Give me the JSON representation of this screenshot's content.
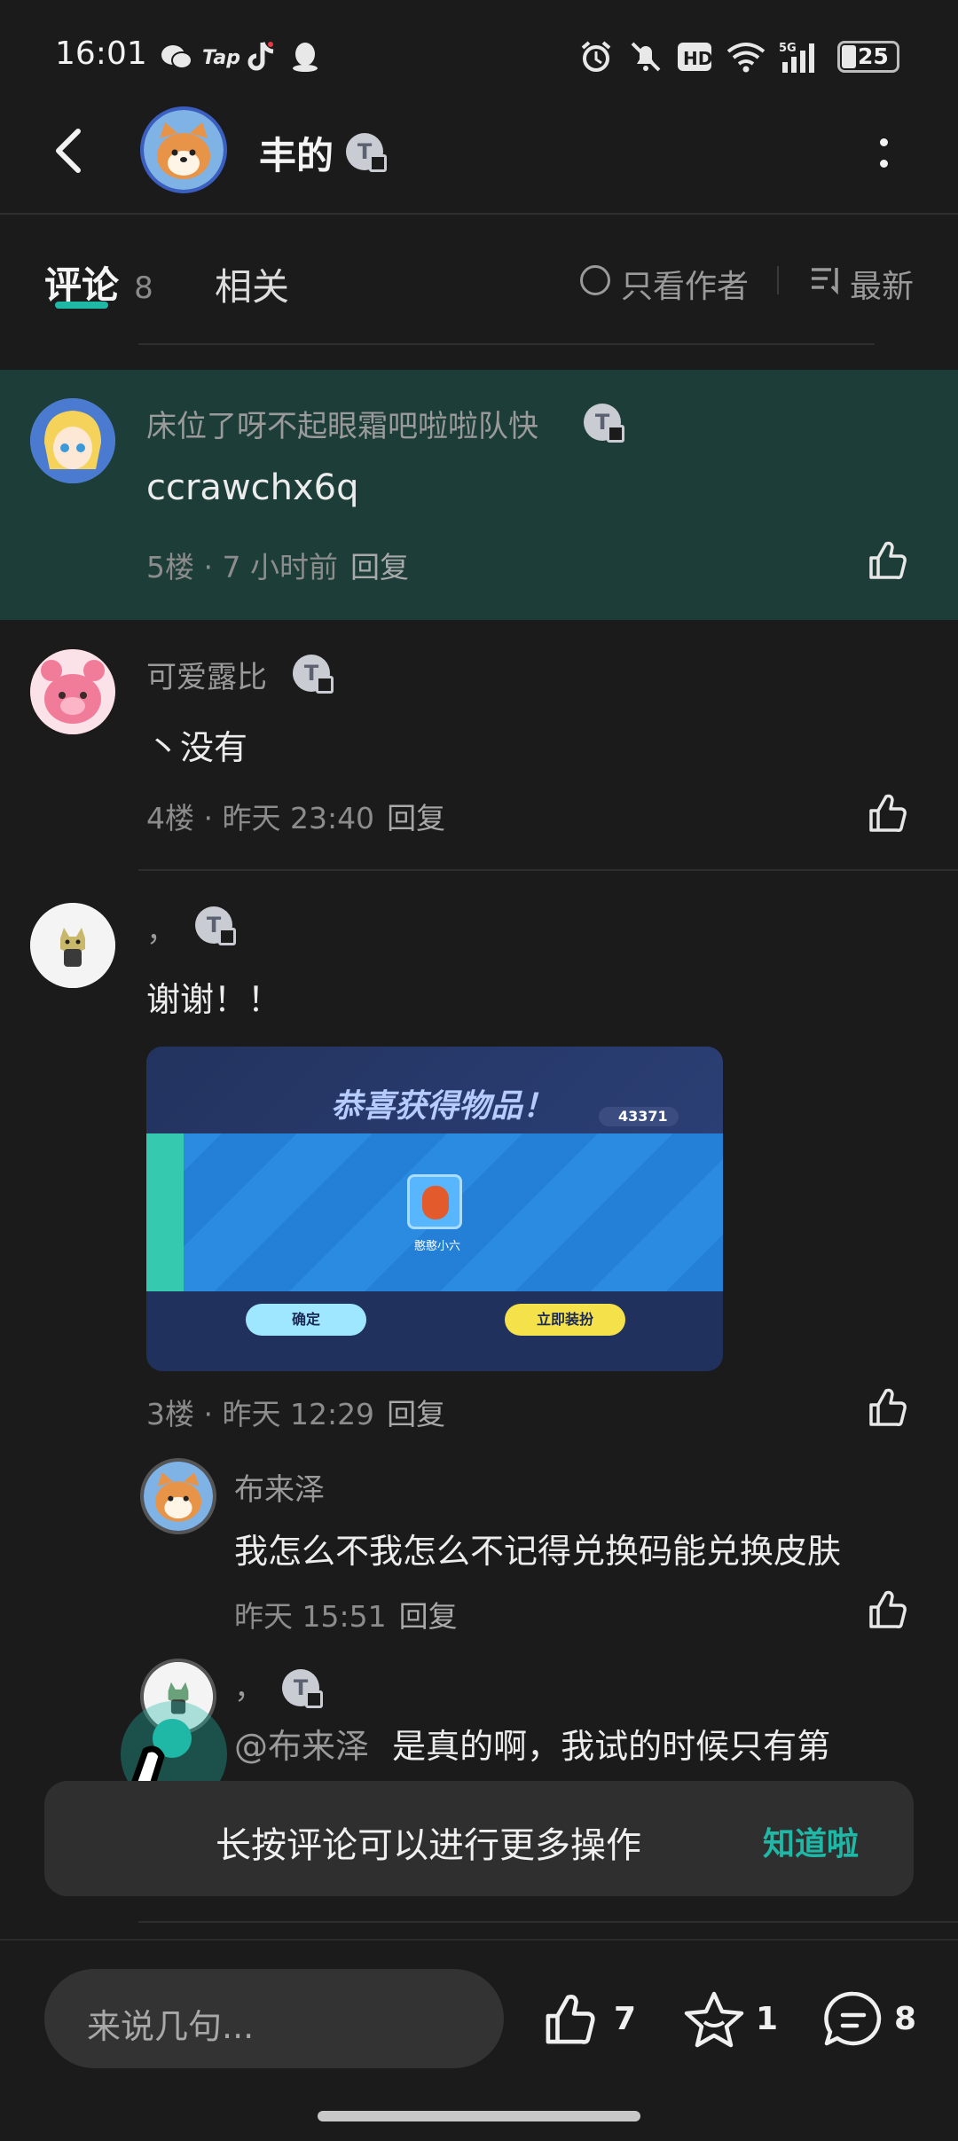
{
  "status_bar": {
    "time": "16:01",
    "battery": "25",
    "icons": [
      "wechat-icon",
      "taptap-icon",
      "douyin-icon",
      "qq-icon",
      "alarm-icon",
      "mute-icon",
      "hd-icon",
      "wifi-icon",
      "5g-signal-icon",
      "battery-icon"
    ]
  },
  "header": {
    "title": "丰的",
    "badge": "T"
  },
  "tabs": {
    "comments_label": "评论",
    "comments_count": "8",
    "related_label": "相关",
    "author_only_label": "只看作者",
    "sort_label": "最新"
  },
  "comments": [
    {
      "name": "床位了呀不起眼霜吧啦啦队快",
      "badge": "T",
      "text": "ccrawchx6q",
      "meta": "5楼 · 7 小时前",
      "reply_label": "回复",
      "highlighted": true
    },
    {
      "name": "可爱露比",
      "badge": "T",
      "text": "丶没有",
      "meta": "4楼 · 昨天 23:40",
      "reply_label": "回复"
    },
    {
      "name": "，",
      "badge": "T",
      "text": "谢谢！！",
      "meta": "3楼 · 昨天 12:29",
      "reply_label": "回复",
      "image": {
        "title": "恭喜获得物品！",
        "currency": "43371",
        "item_label": "憨憨小六",
        "confirm_label": "确定",
        "equip_label": "立即装扮"
      },
      "replies": [
        {
          "name": "布来泽",
          "text": "我怎么不我怎么不记得兑换码能兑换皮肤",
          "meta": "昨天 15:51",
          "reply_label": "回复"
        },
        {
          "name": "，",
          "badge": "T",
          "mention": "@布来泽",
          "text": "是真的啊，我试的时候只有第"
        }
      ]
    }
  ],
  "toast": {
    "message": "长按评论可以进行更多操作",
    "action": "知道啦"
  },
  "bottom_bar": {
    "input_placeholder": "来说几句...",
    "like_count": "7",
    "favorite_count": "1",
    "comment_count": "8"
  },
  "colors": {
    "background": "#1b1b1b",
    "highlight": "#1d3d38",
    "accent": "#1fb8a6"
  }
}
